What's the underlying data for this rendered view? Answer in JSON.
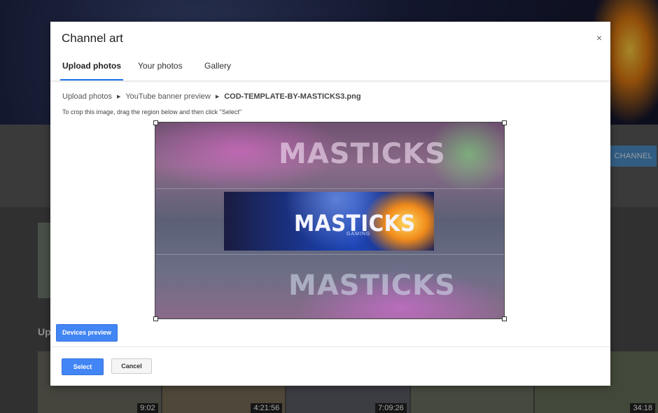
{
  "dialog": {
    "title": "Channel art",
    "close_glyph": "×",
    "tabs": [
      {
        "label": "Upload photos",
        "active": true
      },
      {
        "label": "Your photos",
        "active": false
      },
      {
        "label": "Gallery",
        "active": false
      }
    ],
    "breadcrumb": {
      "items": [
        "Upload photos",
        "YouTube banner preview",
        "COD-TEMPLATE-BY-MASTICKS3.png"
      ],
      "separator_glyph": "▶"
    },
    "instruction": "To crop this image, drag the region below and then click \"Select\"",
    "image": {
      "logo_text": "MASTICKS",
      "logo_sub": "GAMING",
      "ghost_text": "MASTICKS"
    },
    "buttons": {
      "devices_preview": "Devices preview",
      "select": "Select",
      "cancel": "Cancel"
    },
    "colors": {
      "primary": "#4285f4",
      "tab_indicator": "#1a73e8"
    }
  },
  "background": {
    "channel_button": "CHANNEL",
    "section_prefix": "Up",
    "video_durations": [
      "9:02",
      "4:21:56",
      "7:09:26",
      "",
      "34:18"
    ]
  }
}
